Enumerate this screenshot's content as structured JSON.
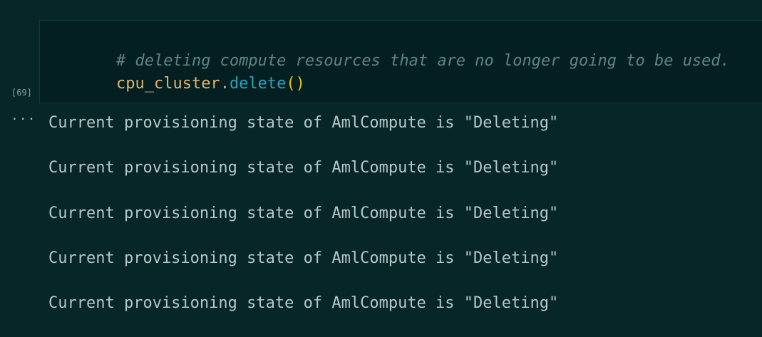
{
  "cell": {
    "execution_count": "[69]",
    "code": {
      "comment": "# deleting compute resources that are no longer going to be used.",
      "object": "cpu_cluster",
      "dot": ".",
      "method": "delete",
      "parens": "()"
    }
  },
  "output": {
    "menu_icon": "ellipsis-icon",
    "menu_glyph": "···",
    "lines": [
      "Current provisioning state of AmlCompute is \"Deleting\"",
      "Current provisioning state of AmlCompute is \"Deleting\"",
      "Current provisioning state of AmlCompute is \"Deleting\"",
      "Current provisioning state of AmlCompute is \"Deleting\"",
      "Current provisioning state of AmlCompute is \"Deleting\""
    ]
  },
  "colors": {
    "background": "#062628",
    "cell_background": "#041f22",
    "comment": "#5f8388",
    "variable": "#e2b46b",
    "function": "#2aa4b8",
    "parens": "#e7c51c",
    "output_text": "#b7c6c8"
  }
}
